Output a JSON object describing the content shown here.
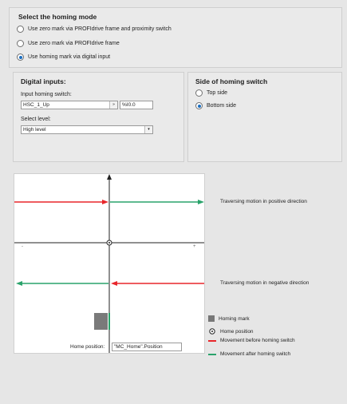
{
  "homing_mode": {
    "title": "Select the homing mode",
    "options": [
      {
        "label": "Use zero mark via PROFIdrive frame and proximity switch",
        "selected": false
      },
      {
        "label": "Use zero mark via PROFIdrive frame",
        "selected": false
      },
      {
        "label": "Use homing mark via digital input",
        "selected": true
      }
    ]
  },
  "digital_inputs": {
    "title": "Digital inputs:",
    "input_label": "Input homing switch:",
    "input_value": "HSC_1_Up",
    "input_address": "%I0.0",
    "level_label": "Select level:",
    "level_value": "High level",
    "dropdown_glyph": "▾",
    "browse_glyph": "»"
  },
  "side": {
    "title": "Side of homing switch",
    "options": [
      {
        "label": "Top side",
        "selected": false
      },
      {
        "label": "Bottom side",
        "selected": true
      }
    ]
  },
  "diagram": {
    "minus_label": "-",
    "plus_label": "+",
    "positive_label": "Traversing motion in positive direction",
    "negative_label": "Traversing motion in negative direction",
    "home_position_label": "Home position:",
    "home_position_value": "\"MC_Home\".Position",
    "colors": {
      "before": "#e8262b",
      "after": "#2aa36b",
      "axis": "#222222",
      "mark": "#7a7a7a"
    }
  },
  "legend": {
    "homing_mark": "Homing mark",
    "home_position": "Home position",
    "movement_before": "Movement before homing switch",
    "movement_after": "Movement after homing switch"
  }
}
